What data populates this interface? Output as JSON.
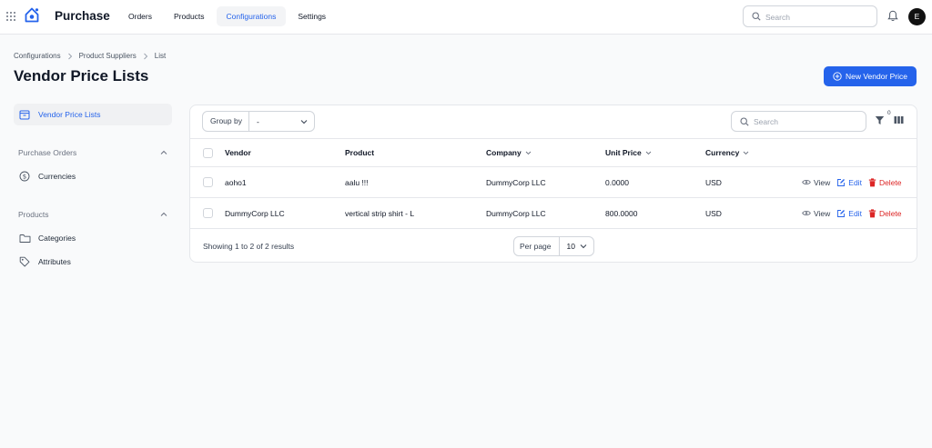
{
  "app": {
    "title": "Purchase",
    "nav": [
      "Orders",
      "Products",
      "Configurations",
      "Settings"
    ],
    "active_nav": "Configurations",
    "search_placeholder": "Search",
    "avatar_initial": "E"
  },
  "breadcrumb": [
    "Configurations",
    "Product Suppliers",
    "List"
  ],
  "page": {
    "title": "Vendor Price Lists",
    "new_button": "New Vendor Price"
  },
  "sidebar": {
    "active_item": "Vendor Price Lists",
    "groups": [
      {
        "label": "Purchase Orders",
        "items": [
          "Currencies"
        ]
      },
      {
        "label": "Products",
        "items": [
          "Categories",
          "Attributes"
        ]
      }
    ]
  },
  "table": {
    "group_by_label": "Group by",
    "group_by_value": "-",
    "search_placeholder": "Search",
    "filter_count": "0",
    "columns": [
      "Vendor",
      "Product",
      "Company",
      "Unit Price",
      "Currency"
    ],
    "rows": [
      {
        "vendor": "aoho1",
        "product": "aalu !!!",
        "company": "DummyCorp LLC",
        "unit_price": "0.0000",
        "currency": "USD"
      },
      {
        "vendor": "DummyCorp LLC",
        "product": "vertical strip shirt - L",
        "company": "DummyCorp LLC",
        "unit_price": "800.0000",
        "currency": "USD"
      }
    ],
    "actions": {
      "view": "View",
      "edit": "Edit",
      "delete": "Delete"
    },
    "footer": "Showing 1 to 2 of 2 results",
    "per_page_label": "Per page",
    "per_page_value": "10"
  },
  "colors": {
    "accent": "#2563eb",
    "danger": "#dc2626",
    "background": "#f9fafb"
  }
}
